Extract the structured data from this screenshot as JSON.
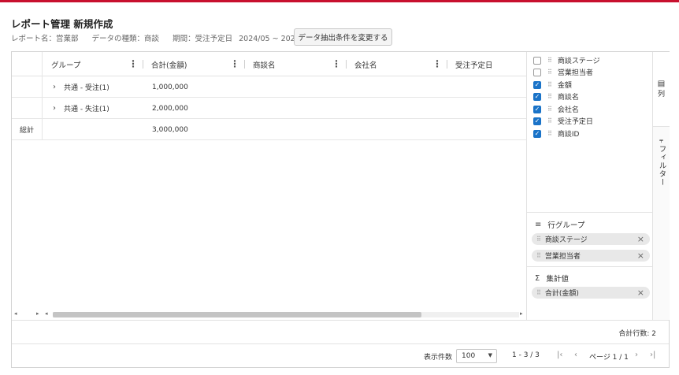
{
  "header": {
    "title": "レポート管理 新規作成",
    "report_name": "レポート名：営業部",
    "data_type": "データの種類：商談",
    "period": "期間：受注予定日",
    "period_range": "2024/05 ~ 2024/07",
    "change_button": "データ抽出条件を変更する"
  },
  "grid": {
    "columns": [
      "グループ",
      "合計(金額)",
      "商談名",
      "会社名",
      "受注予定日"
    ],
    "rows": [
      {
        "group": "共通 - 受注(1)",
        "amount": "1,000,000"
      },
      {
        "group": "共通 - 失注(1)",
        "amount": "2,000,000"
      }
    ],
    "total_label": "総計",
    "total_amount": "3,000,000"
  },
  "sidebar": {
    "columns": [
      {
        "label": "商談ステージ",
        "checked": false
      },
      {
        "label": "営業担当者",
        "checked": false
      },
      {
        "label": "金額",
        "checked": true
      },
      {
        "label": "商談名",
        "checked": true
      },
      {
        "label": "会社名",
        "checked": true
      },
      {
        "label": "受注予定日",
        "checked": true
      },
      {
        "label": "商談ID",
        "checked": true
      }
    ],
    "row_group_title": "行グループ",
    "row_groups": [
      "商談ステージ",
      "営業担当者"
    ],
    "aggregate_title": "集計値",
    "aggregates": [
      "合計(金額)"
    ],
    "tab_columns": "列",
    "tab_filter": "フィルター"
  },
  "footer": {
    "total_rows": "合計行数: 2",
    "per_page_label": "表示件数",
    "per_page_value": "100",
    "range": "1 - 3 / 3",
    "page_indicator": "ページ 1 / 1"
  },
  "colors": {
    "accent": "#c8102e",
    "checkbox": "#1a73c8"
  }
}
